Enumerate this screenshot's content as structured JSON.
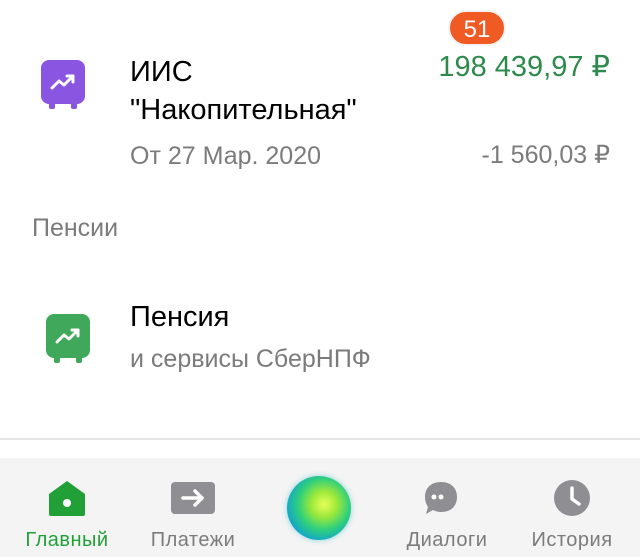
{
  "colors": {
    "accent_green": "#21a038",
    "amount_green": "#2e8a4c",
    "iis_icon": "#8a55e0",
    "pension_icon": "#3fa85a",
    "badge": "#f05a23"
  },
  "iis": {
    "icon": "chart-trend-icon",
    "title_line1": "ИИС",
    "title_line2": "\"Накопительная\"",
    "date": "От 27 Мар. 2020",
    "amount": "198 439,97 ₽",
    "delta": "-1 560,03 ₽"
  },
  "section": {
    "label": "Пенсии"
  },
  "pension": {
    "icon": "chart-trend-icon",
    "title": "Пенсия",
    "subtitle": "и сервисы СберНПФ"
  },
  "tabs": {
    "home": {
      "label": "Главный",
      "icon": "home-icon",
      "active": true
    },
    "payments": {
      "label": "Платежи",
      "icon": "transfer-arrow-icon"
    },
    "assistant": {
      "icon": "salute-orb-icon"
    },
    "dialogs": {
      "label": "Диалоги",
      "icon": "chat-bubble-icon",
      "badge": "51"
    },
    "history": {
      "label": "История",
      "icon": "clock-icon"
    }
  }
}
